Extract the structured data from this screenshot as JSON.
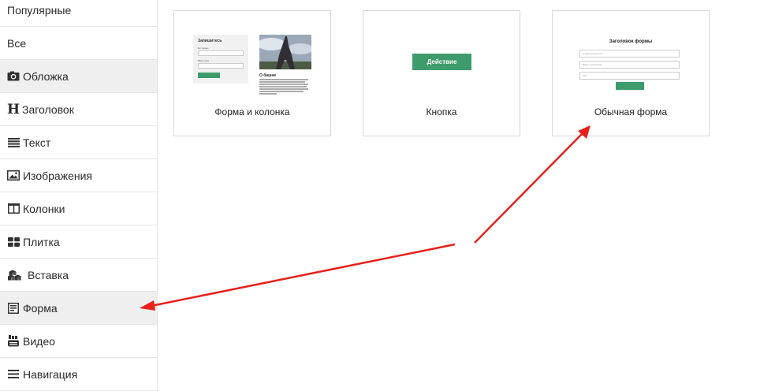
{
  "sidebar": {
    "items": [
      {
        "label": "Популярные",
        "icon": "none"
      },
      {
        "label": "Все",
        "icon": "none"
      },
      {
        "label": "Обложка",
        "icon": "camera-icon"
      },
      {
        "label": "Заголовок",
        "icon": "heading-icon"
      },
      {
        "label": "Текст",
        "icon": "text-lines-icon"
      },
      {
        "label": "Изображения",
        "icon": "image-icon"
      },
      {
        "label": "Колонки",
        "icon": "columns-icon"
      },
      {
        "label": "Плитка",
        "icon": "tiles-icon"
      },
      {
        "label": "Вставка",
        "icon": "cubes-icon"
      },
      {
        "label": "Форма",
        "icon": "form-icon"
      },
      {
        "label": "Видео",
        "icon": "youtube-icon"
      },
      {
        "label": "Навигация",
        "icon": "hamburger-icon"
      }
    ],
    "active": [
      "Обложка",
      "Форма"
    ],
    "heading_glyph": "H"
  },
  "cards": [
    {
      "title": "Форма и колонка",
      "preview": {
        "form_heading": "Запишитесь",
        "field1_label": "Ел. адрес",
        "field2_label": "Ваше имя",
        "text_heading": "О башне"
      }
    },
    {
      "title": "Кнопка",
      "preview": {
        "button_label": "Действие"
      }
    },
    {
      "title": "Обычная форма",
      "preview": {
        "heading": "Заголовок формы",
        "field1_placeholder": "you@example.com",
        "field2_placeholder": "Ваше сообщение",
        "field3_placeholder": "123"
      }
    }
  ],
  "colors": {
    "accent_green": "#3e9b6b",
    "annotation_arrow": "#e8201a",
    "active_bg": "#efefef"
  }
}
